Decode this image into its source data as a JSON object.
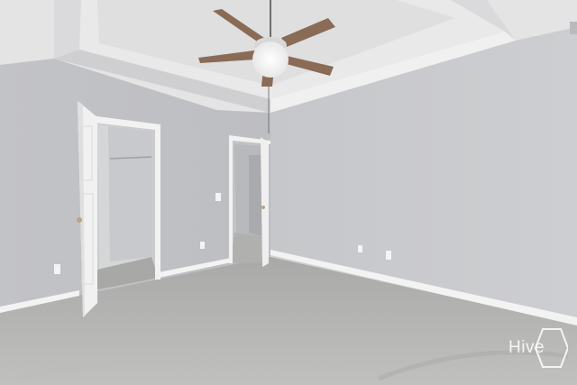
{
  "photo": {
    "subject": "empty-bedroom",
    "colors": {
      "wall_left": "#c3c4c8",
      "wall_right": "#c9cacd",
      "ceiling": "#e6e6e7",
      "carpet": "#b5b5b4",
      "trim": "#f4f4f4",
      "fan_blade": "#8a6b55"
    }
  },
  "watermark": {
    "text": "Hive"
  }
}
